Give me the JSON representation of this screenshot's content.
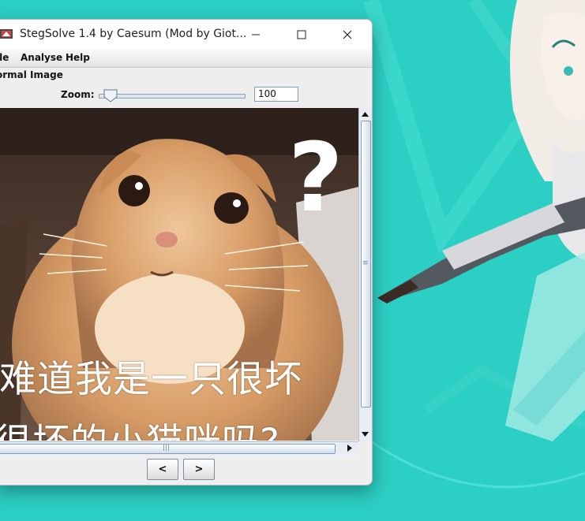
{
  "window": {
    "title": "StegSolve 1.4 by Caesum (Mod by Giot..."
  },
  "menu": {
    "items": [
      {
        "label": "ile"
      },
      {
        "label": "Analyse"
      },
      {
        "label": "Help"
      }
    ]
  },
  "viewer": {
    "image_label": "ormal Image",
    "zoom_label": "Zoom:",
    "zoom_value": "100",
    "zoom_level": 100
  },
  "image": {
    "caption_line1": "难道我是一只很坏",
    "caption_line2": "很坏的小猫咪吗?",
    "question_mark": "?"
  },
  "nav": {
    "prev_label": "<",
    "next_label": ">"
  },
  "colors": {
    "desktop_bg": "#2ccfc4",
    "window_bg": "#eeeeee",
    "scrollbar_border": "#7f9db9"
  }
}
